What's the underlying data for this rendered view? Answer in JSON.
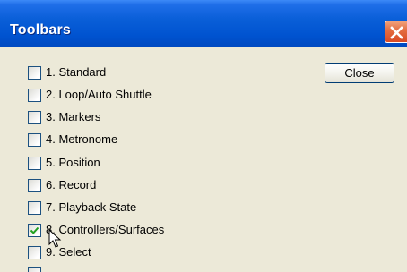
{
  "window": {
    "title": "Toolbars",
    "close_icon": "close-icon"
  },
  "buttons": {
    "close_label": "Close"
  },
  "colors": {
    "titlebar": "#0053d0",
    "client_bg": "#ece9d8",
    "close_x": "#e36b3f",
    "checkmark": "#21a121"
  },
  "toolbars": [
    {
      "label": "1. Standard",
      "checked": false
    },
    {
      "label": "2. Loop/Auto Shuttle",
      "checked": false
    },
    {
      "label": "3. Markers",
      "checked": false
    },
    {
      "label": "4. Metronome",
      "checked": false
    },
    {
      "label": "5. Position",
      "checked": false
    },
    {
      "label": "6. Record",
      "checked": false
    },
    {
      "label": "7. Playback State",
      "checked": false
    },
    {
      "label": "8. Controllers/Surfaces",
      "checked": true
    },
    {
      "label": "9. Select",
      "checked": false
    }
  ]
}
